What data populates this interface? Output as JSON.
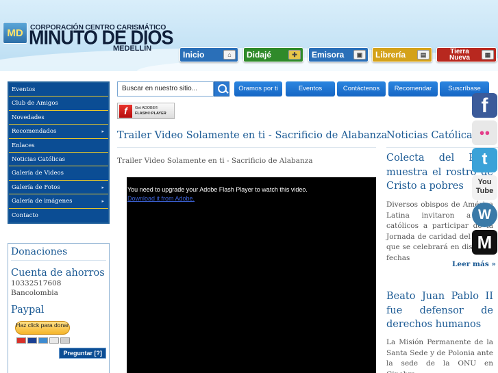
{
  "header": {
    "logo_initials": "MD",
    "org_line": "CORPORACIÓN CENTRO CARISMÁTICO",
    "org_name": "MINUTO DE DIOS",
    "city": "MEDELLÍN",
    "nav": [
      {
        "label": "Inicio",
        "color": "#2a6fb8",
        "icon": "home-icon"
      },
      {
        "label": "Didajé",
        "color": "#2f8a2a",
        "icon": "cross-icon"
      },
      {
        "label": "Emisora",
        "color": "#2a6fb8",
        "icon": "radio-icon"
      },
      {
        "label": "Librería",
        "color": "#d4a21a",
        "icon": "book-icon"
      },
      {
        "label": "Tierra Nueva",
        "color": "#b8281f",
        "icon": "image-icon"
      }
    ]
  },
  "sidebar": {
    "menu": [
      {
        "label": "Eventos",
        "has_sub": false
      },
      {
        "label": "Club de Amigos",
        "has_sub": false
      },
      {
        "label": "Novedades",
        "has_sub": false
      },
      {
        "label": "Recomendados",
        "has_sub": true
      },
      {
        "label": "Enlaces",
        "has_sub": false
      },
      {
        "label": "Noticias Católicas",
        "has_sub": false
      },
      {
        "label": "Galería de Videos",
        "has_sub": false
      },
      {
        "label": "Galería de Fotos",
        "has_sub": true
      },
      {
        "label": "Galería de imágenes",
        "has_sub": true
      },
      {
        "label": "Contacto",
        "has_sub": false
      }
    ],
    "submenu_arrow": "▸",
    "donations": {
      "title": "Donaciones",
      "account_title": "Cuenta de ahorros",
      "account_number": "10332517608",
      "bank": "Bancolombia",
      "paypal_title": "Paypal",
      "paypal_button": "Haz click para donar",
      "ask_button": "Preguntar [?]"
    }
  },
  "search": {
    "placeholder": "Buscar en nuestro sitio..."
  },
  "navbar": [
    "Oramos por ti",
    "Eventos",
    "Contáctenos",
    "Recomendar",
    "Suscríbase"
  ],
  "flash_badge": {
    "line1": "Get ADOBE®",
    "line2": "FLASH® PLAYER"
  },
  "main": {
    "title": "Trailer Video Solamente en ti - Sacrificio de Alabanza",
    "subtitle": "Trailer Video Solamente en ti - Sacrificio de Alabanza",
    "video_message": "You need to upgrade your Adobe Flash Player to watch this video.",
    "video_link": "Download it from Adobe."
  },
  "news": {
    "title": "Noticias Católicas",
    "articles": [
      {
        "title": "Colecta del Papa muestra el rostro de Cristo a pobres",
        "body": "Diversos obispos de América Latina invitaron a los católicos a participar de la Jornada de caridad del Papa, que se celebrará en distintas fechas",
        "more": "Leer más »"
      },
      {
        "title": "Beato Juan Pablo II fue defensor de derechos humanos",
        "body": "La Misión Permanente de la Santa Sede y de Polonia ante la sede de la ONU en Ginebra"
      }
    ]
  },
  "social": [
    {
      "name": "facebook",
      "glyph": "f",
      "color": "#3b5b9a"
    },
    {
      "name": "flickr",
      "glyph": "●●",
      "color": "#e8e8e8"
    },
    {
      "name": "twitter",
      "glyph": "t",
      "color": "#3aa2d8"
    },
    {
      "name": "youtube",
      "glyph": "You Tube",
      "color": "#f2f2f2"
    },
    {
      "name": "wordpress",
      "glyph": "W",
      "color": "#3a7aa8"
    },
    {
      "name": "gmail",
      "glyph": "M",
      "color": "#111111"
    }
  ]
}
